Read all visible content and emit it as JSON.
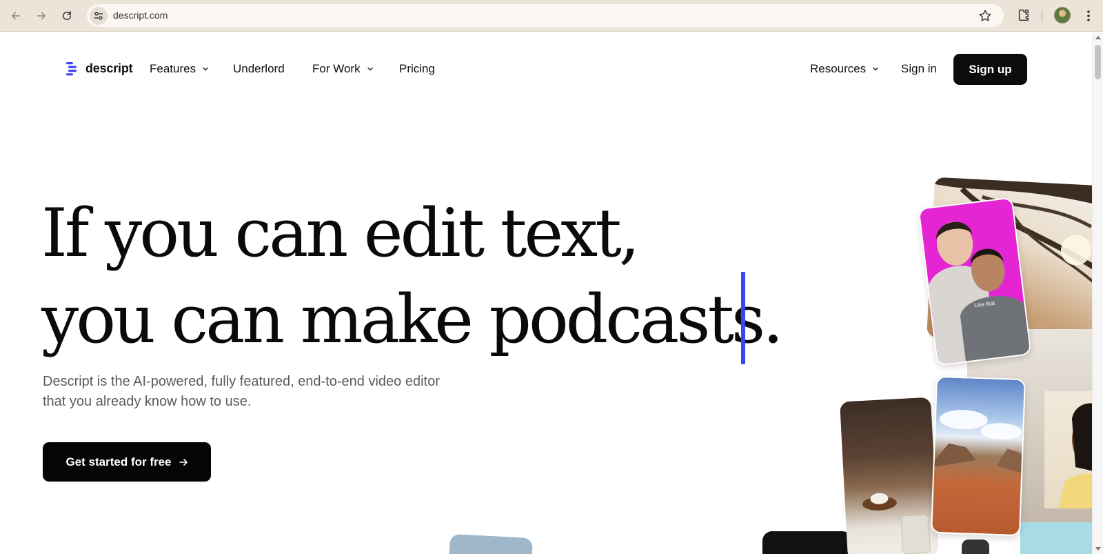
{
  "browser": {
    "url": "descript.com",
    "icons": {
      "back": "arrow-left-icon",
      "forward": "arrow-right-icon",
      "reload": "reload-icon",
      "site_info": "tune-icon",
      "bookmark": "star-icon",
      "extensions": "puzzle-icon",
      "profile": "avatar",
      "menu": "kebab-icon"
    }
  },
  "nav": {
    "logo_text": "descript",
    "items": [
      {
        "label": "Features",
        "has_dropdown": true
      },
      {
        "label": "Underlord",
        "has_dropdown": false
      },
      {
        "label": "For Work",
        "has_dropdown": true
      },
      {
        "label": "Pricing",
        "has_dropdown": false
      }
    ],
    "resources_label": "Resources",
    "signin_label": "Sign in",
    "signup_label": "Sign up"
  },
  "hero": {
    "line1": "If you can edit text,",
    "line2": "you can make podcasts.",
    "subtitle_line1": "Descript is the AI-powered, fully featured, end-to-end video editor",
    "subtitle_line2": "that you already know how to use.",
    "cta_label": "Get started for free",
    "caption_text": "Like that"
  },
  "colors": {
    "chrome_bg": "#ece4d8",
    "brand_blue": "#3d45f0",
    "button_black": "#0c0c0c",
    "pink_card": "#e525d4"
  }
}
